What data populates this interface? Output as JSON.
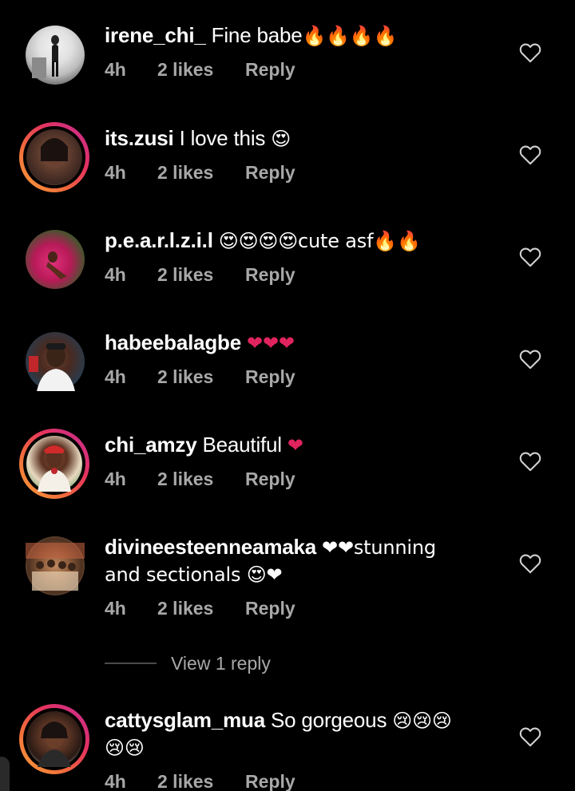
{
  "comments": [
    {
      "username": "irene_chi_",
      "text": "Fine babe",
      "emoji": "🔥🔥🔥🔥",
      "time": "4h",
      "likes": "2 likes",
      "reply": "Reply",
      "story_ring": false
    },
    {
      "username": "its.zusi",
      "text": "I love this",
      "emoji": "😍",
      "time": "4h",
      "likes": "2 likes",
      "reply": "Reply",
      "story_ring": true
    },
    {
      "username": "p.e.a.r.l.z.i.l",
      "text": "😍😍😍😍cute asf🔥🔥",
      "emoji": "",
      "time": "4h",
      "likes": "2 likes",
      "reply": "Reply",
      "story_ring": false
    },
    {
      "username": "habeebalagbe",
      "text": "",
      "emoji": "❤❤❤",
      "time": "4h",
      "likes": "2 likes",
      "reply": "Reply",
      "story_ring": false
    },
    {
      "username": "chi_amzy",
      "text": "Beautiful",
      "emoji": "❤",
      "time": "4h",
      "likes": "2 likes",
      "reply": "Reply",
      "story_ring": true
    },
    {
      "username": "divineesteenneamaka",
      "text": "❤❤stunning",
      "text2": "and sectionals 😍❤",
      "emoji": "",
      "time": "4h",
      "likes": "2 likes",
      "reply": "Reply",
      "story_ring": false,
      "view_replies": "View 1 reply"
    },
    {
      "username": "cattysglam_mua",
      "text": "So gorgeous",
      "emoji": "😢😢😢",
      "text2": "😢😢",
      "time": "4h",
      "likes": "2 likes",
      "reply": "Reply",
      "story_ring": true
    }
  ],
  "icons": {
    "like": "heart-outline-icon"
  },
  "colors": {
    "background": "#000000",
    "text_primary": "#ffffff",
    "text_secondary": "#a8a8a8",
    "heart_emoji": "#e0245e",
    "story_ring_start": "#f9a13a",
    "story_ring_end": "#c12e96"
  }
}
